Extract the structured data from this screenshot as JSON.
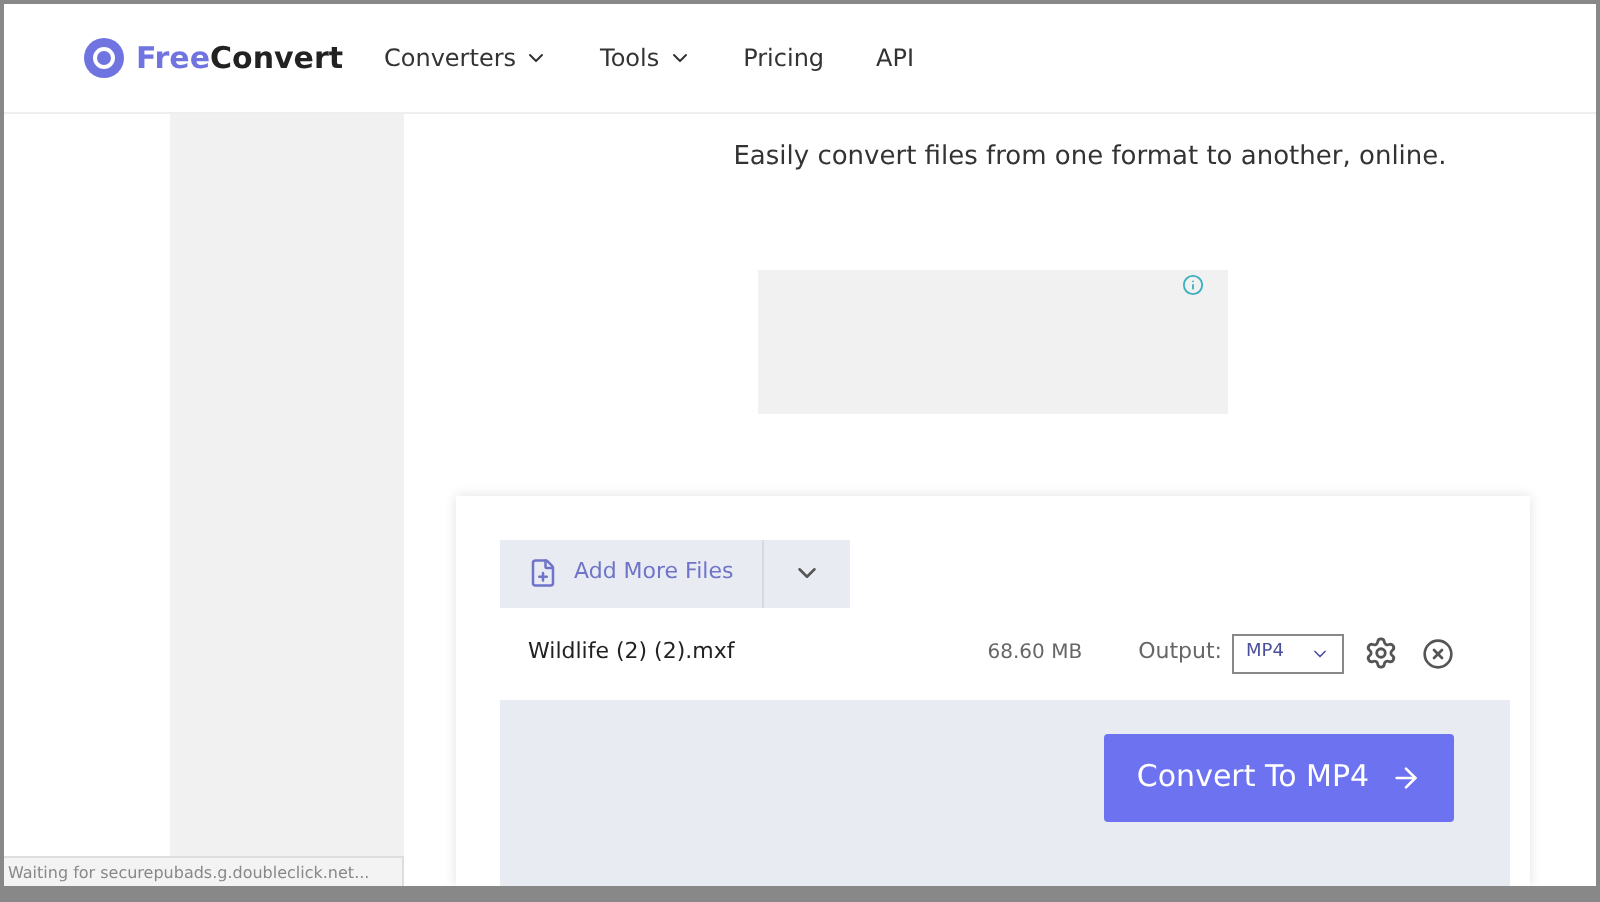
{
  "header": {
    "logo": {
      "part_1": "Free",
      "part_2": "Convert"
    },
    "nav": [
      {
        "label": "Converters",
        "kind": "dropdown"
      },
      {
        "label": "Tools",
        "kind": "dropdown"
      },
      {
        "label": "Pricing",
        "kind": "link"
      },
      {
        "label": "API",
        "kind": "link"
      }
    ]
  },
  "tagline": "Easily convert files from one format to another, online.",
  "uploader": {
    "add_button": "Add More Files",
    "file": {
      "name": "Wildlife (2) (2).mxf",
      "size": "68.60 MB",
      "output_label": "Output:",
      "output_format": "MP4"
    },
    "convert_button": "Convert To MP4"
  },
  "status_bar": "Waiting for securepubads.g.doubleclick.net..."
}
